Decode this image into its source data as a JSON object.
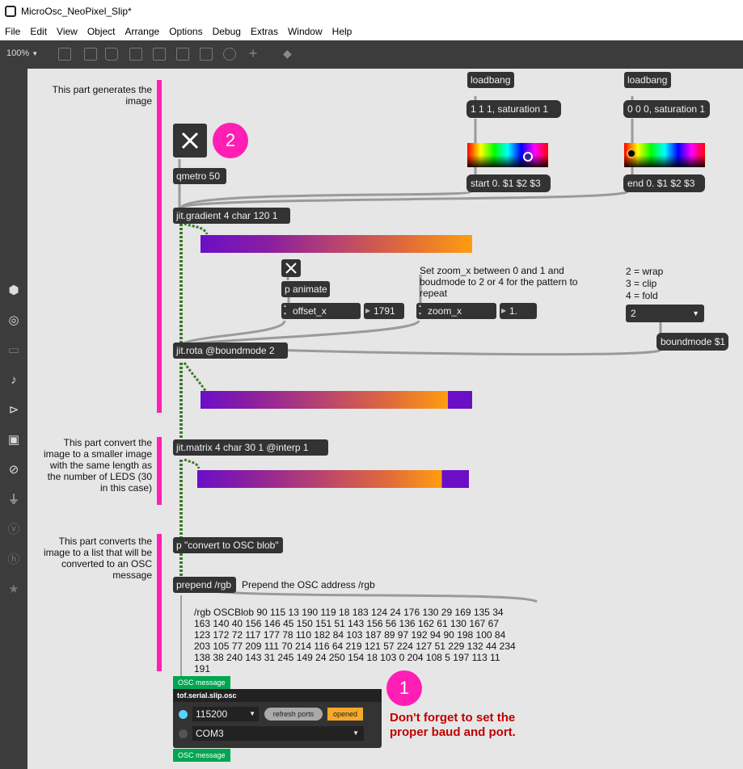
{
  "window": {
    "title": "MicroOsc_NeoPixel_Slip*"
  },
  "menu": [
    "File",
    "Edit",
    "View",
    "Object",
    "Arrange",
    "Options",
    "Debug",
    "Extras",
    "Window",
    "Help"
  ],
  "toolbar": {
    "zoom": "100%",
    "zoom_arrow": "▼"
  },
  "comments": {
    "generates": "This part generates the image",
    "convert_small": "This part convert the image to a smaller image with the same length as the number of LEDS (30 in this case)",
    "convert_list": "This part converts the image to a list that will be converted to an OSC message",
    "zoom_hint": "Set zoom_x between 0 and 1 and boudmode to 2 or 4 for the pattern to repeat",
    "bound_legend_1": "2 = wrap",
    "bound_legend_2": "3 = clip",
    "bound_legend_3": "4 = fold",
    "prepend_hint": "Prepend the OSC address /rgb"
  },
  "objects": {
    "loadbang1": "loadbang",
    "loadbang2": "loadbang",
    "msg_sat1": "1 1 1, saturation 1",
    "msg_sat2": "0 0 0, saturation 1",
    "msg_start": "start 0. $1 $2 $3",
    "msg_end": "end 0. $1 $2 $3",
    "qmetro": "qmetro 50",
    "gradient": "jit.gradient 4 char 120 1",
    "p_animate": "p animate",
    "offset_x": "offset_x",
    "offset_val": "1791",
    "zoom_x": "zoom_x",
    "zoom_val": "1.",
    "boundmode_menu": "2",
    "boundmode_msg": "boundmode $1",
    "rota": "jit.rota @boundmode 2",
    "matrix": "jit.matrix 4 char 30 1 @interp 1",
    "convert": "p \"convert to OSC blob\"",
    "prepend": "prepend /rgb"
  },
  "osc_output": "/rgb OSCBlob 90 115 13 190 119 18 183 124 24 176 130 29 169 135 34 163 140 40 156 146 45 150 151 51 143 156 56 136 162 61 130 167 67 123 172 72 117 177 78 110 182 84 103 187 89 97 192 94 90 198 100 84 203 105 77 209 111 70 214 116 64 219 121 57 224 127 51 229 132 44 234 138 38 240 143 31 245 149 24 250 154 18 103 0 204 108 5 197 113 11 191",
  "serial": {
    "osc_in_label": "OSC message",
    "osc_out_label": "OSC message",
    "title": "tof.serial.slip.osc",
    "baud": "115200",
    "refresh": "refresh ports",
    "opened": "opened",
    "port": "COM3"
  },
  "badges": {
    "one": "1",
    "two": "2"
  },
  "warning": "Don't forget to set the proper baud and port.",
  "colors": {
    "pink": "#ff1fb4",
    "object_bg": "#333333",
    "green": "#00a651",
    "warning": "#c00000",
    "opened": "#f7a928",
    "toggle_on": "#5ad1ff"
  }
}
